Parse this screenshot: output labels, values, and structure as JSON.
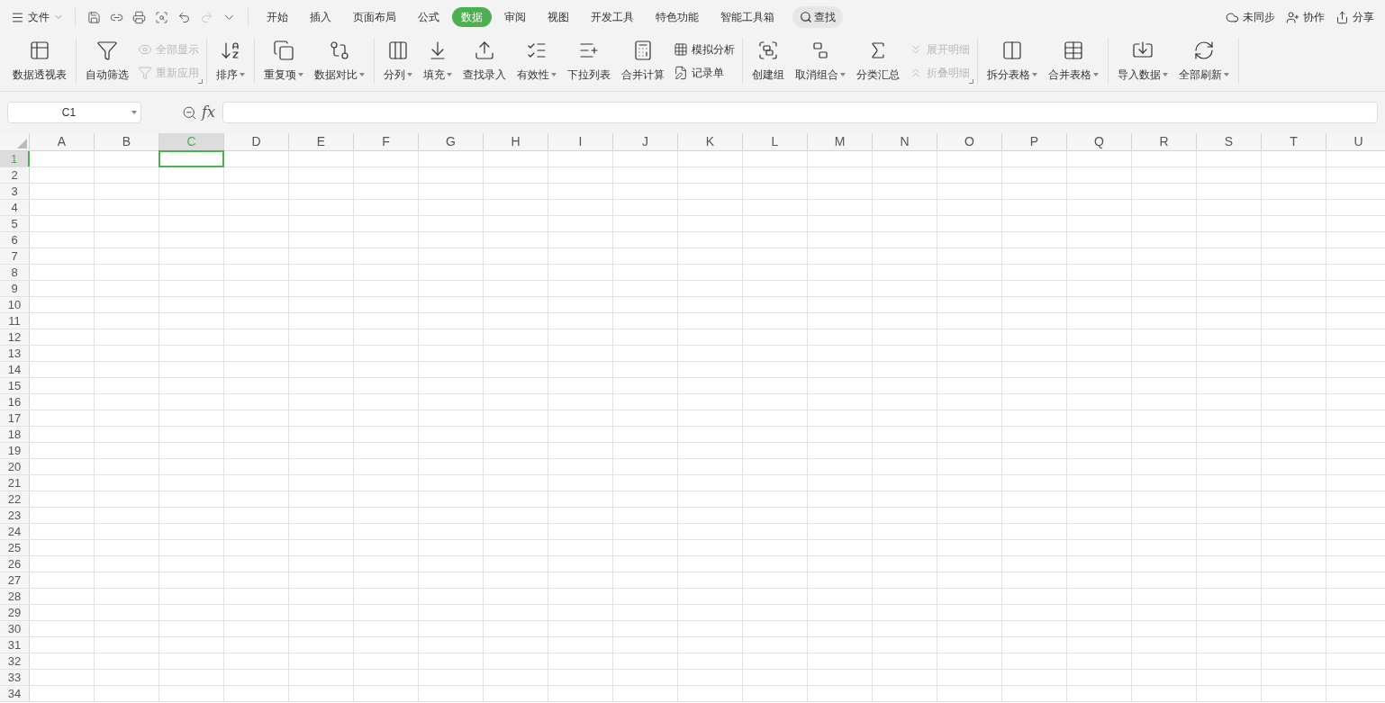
{
  "menu": {
    "label": "文件"
  },
  "quick_access": [
    {
      "disabled": false
    },
    {
      "disabled": false
    },
    {
      "disabled": false
    },
    {
      "disabled": false
    },
    {
      "disabled": false
    },
    {
      "disabled": true
    },
    {
      "disabled": false
    }
  ],
  "tabs": [
    {
      "label": "开始",
      "selected": false
    },
    {
      "label": "插入",
      "selected": false
    },
    {
      "label": "页面布局",
      "selected": false
    },
    {
      "label": "公式",
      "selected": false
    },
    {
      "label": "数据",
      "selected": true
    },
    {
      "label": "审阅",
      "selected": false
    },
    {
      "label": "视图",
      "selected": false
    },
    {
      "label": "开发工具",
      "selected": false
    },
    {
      "label": "特色功能",
      "selected": false
    },
    {
      "label": "智能工具箱",
      "selected": false
    }
  ],
  "search": {
    "label": "查找"
  },
  "right_actions": [
    {
      "label": "未同步"
    },
    {
      "label": "协作"
    },
    {
      "label": "分享"
    }
  ],
  "ribbon_groups": [
    {
      "launcher": false,
      "items": [
        {
          "label": "数据透视表",
          "kind": "large",
          "dropdown": false,
          "disabled": false
        }
      ]
    },
    {
      "launcher": true,
      "items": [
        {
          "label": "自动筛选",
          "kind": "large",
          "dropdown": false,
          "disabled": false
        },
        {
          "label": "全部显示",
          "kind": "small",
          "dropdown": false,
          "disabled": true
        },
        {
          "label": "重新应用",
          "kind": "small",
          "dropdown": false,
          "disabled": true
        }
      ]
    },
    {
      "launcher": false,
      "items": [
        {
          "label": "排序",
          "kind": "large",
          "dropdown": true,
          "disabled": false
        }
      ]
    },
    {
      "launcher": false,
      "items": [
        {
          "label": "重复项",
          "kind": "large",
          "dropdown": true,
          "disabled": false
        },
        {
          "label": "数据对比",
          "kind": "large",
          "dropdown": true,
          "disabled": false
        }
      ]
    },
    {
      "launcher": false,
      "items": [
        {
          "label": "分列",
          "kind": "large",
          "dropdown": true,
          "disabled": false
        },
        {
          "label": "填充",
          "kind": "large",
          "dropdown": true,
          "disabled": false
        },
        {
          "label": "查找录入",
          "kind": "large",
          "dropdown": false,
          "disabled": false
        },
        {
          "label": "有效性",
          "kind": "large",
          "dropdown": true,
          "disabled": false
        },
        {
          "label": "下拉列表",
          "kind": "large",
          "dropdown": false,
          "disabled": false
        },
        {
          "label": "合并计算",
          "kind": "large",
          "dropdown": false,
          "disabled": false
        },
        {
          "label": "模拟分析",
          "kind": "small",
          "dropdown": false,
          "disabled": false
        },
        {
          "label": "记录单",
          "kind": "small",
          "dropdown": false,
          "disabled": false
        }
      ]
    },
    {
      "launcher": true,
      "items": [
        {
          "label": "创建组",
          "kind": "large",
          "dropdown": false,
          "disabled": false
        },
        {
          "label": "取消组合",
          "kind": "large",
          "dropdown": true,
          "disabled": false
        },
        {
          "label": "分类汇总",
          "kind": "large",
          "dropdown": false,
          "disabled": false
        },
        {
          "label": "展开明细",
          "kind": "small",
          "dropdown": false,
          "disabled": true
        },
        {
          "label": "折叠明细",
          "kind": "small",
          "dropdown": false,
          "disabled": true
        }
      ]
    },
    {
      "launcher": false,
      "items": [
        {
          "label": "拆分表格",
          "kind": "large",
          "dropdown": true,
          "disabled": false
        },
        {
          "label": "合并表格",
          "kind": "large",
          "dropdown": true,
          "disabled": false
        }
      ]
    },
    {
      "launcher": false,
      "items": [
        {
          "label": "导入数据",
          "kind": "large",
          "dropdown": true,
          "disabled": false
        },
        {
          "label": "全部刷新",
          "kind": "large",
          "dropdown": true,
          "disabled": false
        }
      ]
    }
  ],
  "name_box": {
    "value": "C1"
  },
  "formula_bar": {
    "label": "fx"
  },
  "columns": [
    {
      "label": "A",
      "selected": false
    },
    {
      "label": "B",
      "selected": false
    },
    {
      "label": "C",
      "selected": true
    },
    {
      "label": "D",
      "selected": false
    },
    {
      "label": "E",
      "selected": false
    },
    {
      "label": "F",
      "selected": false
    },
    {
      "label": "G",
      "selected": false
    },
    {
      "label": "H",
      "selected": false
    },
    {
      "label": "I",
      "selected": false
    },
    {
      "label": "J",
      "selected": false
    },
    {
      "label": "K",
      "selected": false
    },
    {
      "label": "L",
      "selected": false
    },
    {
      "label": "M",
      "selected": false
    },
    {
      "label": "N",
      "selected": false
    },
    {
      "label": "O",
      "selected": false
    },
    {
      "label": "P",
      "selected": false
    },
    {
      "label": "Q",
      "selected": false
    },
    {
      "label": "R",
      "selected": false
    },
    {
      "label": "S",
      "selected": false
    },
    {
      "label": "T",
      "selected": false
    },
    {
      "label": "U",
      "selected": false
    }
  ],
  "rows": [
    {
      "label": "1",
      "selected": true
    },
    {
      "label": "2",
      "selected": false
    },
    {
      "label": "3",
      "selected": false
    },
    {
      "label": "4",
      "selected": false
    },
    {
      "label": "5",
      "selected": false
    },
    {
      "label": "6",
      "selected": false
    },
    {
      "label": "7",
      "selected": false
    },
    {
      "label": "8",
      "selected": false
    },
    {
      "label": "9",
      "selected": false
    },
    {
      "label": "10",
      "selected": false
    },
    {
      "label": "11",
      "selected": false
    },
    {
      "label": "12",
      "selected": false
    },
    {
      "label": "13",
      "selected": false
    },
    {
      "label": "14",
      "selected": false
    },
    {
      "label": "15",
      "selected": false
    },
    {
      "label": "16",
      "selected": false
    },
    {
      "label": "17",
      "selected": false
    },
    {
      "label": "18",
      "selected": false
    },
    {
      "label": "19",
      "selected": false
    },
    {
      "label": "20",
      "selected": false
    },
    {
      "label": "21",
      "selected": false
    },
    {
      "label": "22",
      "selected": false
    },
    {
      "label": "23",
      "selected": false
    },
    {
      "label": "24",
      "selected": false
    },
    {
      "label": "25",
      "selected": false
    },
    {
      "label": "26",
      "selected": false
    },
    {
      "label": "27",
      "selected": false
    },
    {
      "label": "28",
      "selected": false
    },
    {
      "label": "29",
      "selected": false
    },
    {
      "label": "30",
      "selected": false
    },
    {
      "label": "31",
      "selected": false
    },
    {
      "label": "32",
      "selected": false
    },
    {
      "label": "33",
      "selected": false
    },
    {
      "label": "34",
      "selected": false
    }
  ]
}
